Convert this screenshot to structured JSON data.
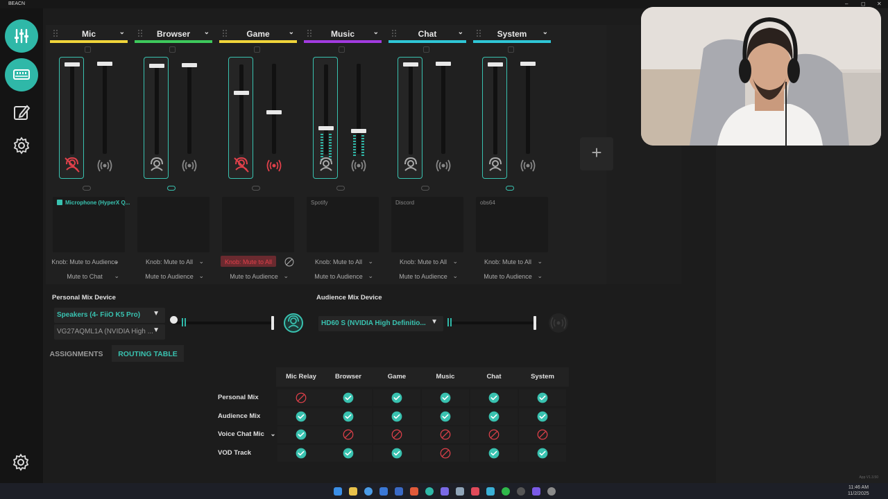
{
  "window": {
    "title": "BEACN",
    "controls": [
      "–",
      "◻",
      "✕"
    ]
  },
  "sidebar": {
    "items": [
      {
        "icon": "mixer-icon",
        "active": true
      },
      {
        "icon": "device-icon",
        "active": true
      },
      {
        "icon": "edit-icon",
        "active": false
      },
      {
        "icon": "gear-icon",
        "active": false
      }
    ]
  },
  "channels": [
    {
      "name": "Mic",
      "color": "#f0d43a",
      "app": "Microphone (HyperX Q...",
      "app_teal": true,
      "knob": "Knob: Mute to Audience",
      "mute": "Mute to Chat",
      "linked": false
    },
    {
      "name": "Browser",
      "color": "#3ec95c",
      "app": "",
      "app_teal": false,
      "knob": "Knob: Mute to All",
      "mute": "Mute to Audience",
      "linked": true
    },
    {
      "name": "Game",
      "color": "#f0d43a",
      "app": "",
      "app_teal": false,
      "knob": "Knob: Mute to All",
      "mute": "Mute to Audience",
      "linked": false,
      "alert": true
    },
    {
      "name": "Music",
      "color": "#a23be0",
      "app": "Spotify",
      "app_teal": false,
      "knob": "Knob: Mute to All",
      "mute": "Mute to Audience",
      "linked": false
    },
    {
      "name": "Chat",
      "color": "#2fc6d6",
      "app": "Discord",
      "app_teal": false,
      "knob": "Knob: Mute to All",
      "mute": "Mute to Audience",
      "linked": false
    },
    {
      "name": "System",
      "color": "#2fc6d6",
      "app": "obs64",
      "app_teal": false,
      "knob": "Knob: Mute to All",
      "mute": "Mute to Audience",
      "linked": true
    }
  ],
  "add_channel_label": "+",
  "personal_mix": {
    "title": "Personal Mix Device",
    "device1": "Speakers (4- FiiO K5 Pro)",
    "device2": "VG27AQML1A (NVIDIA High ...",
    "dropdown_arrow": "▼"
  },
  "audience_mix": {
    "title": "Audience Mix Device",
    "device1": "HD60 S (NVIDIA High Definitio...",
    "dropdown_arrow": "▼"
  },
  "tabs": {
    "assignments": "ASSIGNMENTS",
    "routing": "ROUTING TABLE"
  },
  "routing_table": {
    "columns": [
      "Mic Relay",
      "Browser",
      "Game",
      "Music",
      "Chat",
      "System"
    ],
    "rows": [
      {
        "label": "Personal Mix",
        "cells": [
          false,
          true,
          true,
          true,
          true,
          true
        ]
      },
      {
        "label": "Audience Mix",
        "cells": [
          true,
          true,
          true,
          true,
          true,
          true
        ]
      },
      {
        "label": "Voice Chat Mic",
        "cells": [
          true,
          false,
          false,
          false,
          false,
          false
        ],
        "dropdown": "⌄"
      },
      {
        "label": "VOD Track",
        "cells": [
          true,
          true,
          true,
          false,
          true,
          true
        ]
      }
    ]
  },
  "colors": {
    "accent": "#39c2b0",
    "ok": "#39c2b0",
    "blocked": "#e0404a"
  },
  "taskbar": {
    "time": "11:46 AM",
    "date": "11/2/2025"
  },
  "version": "App V1.3.50"
}
